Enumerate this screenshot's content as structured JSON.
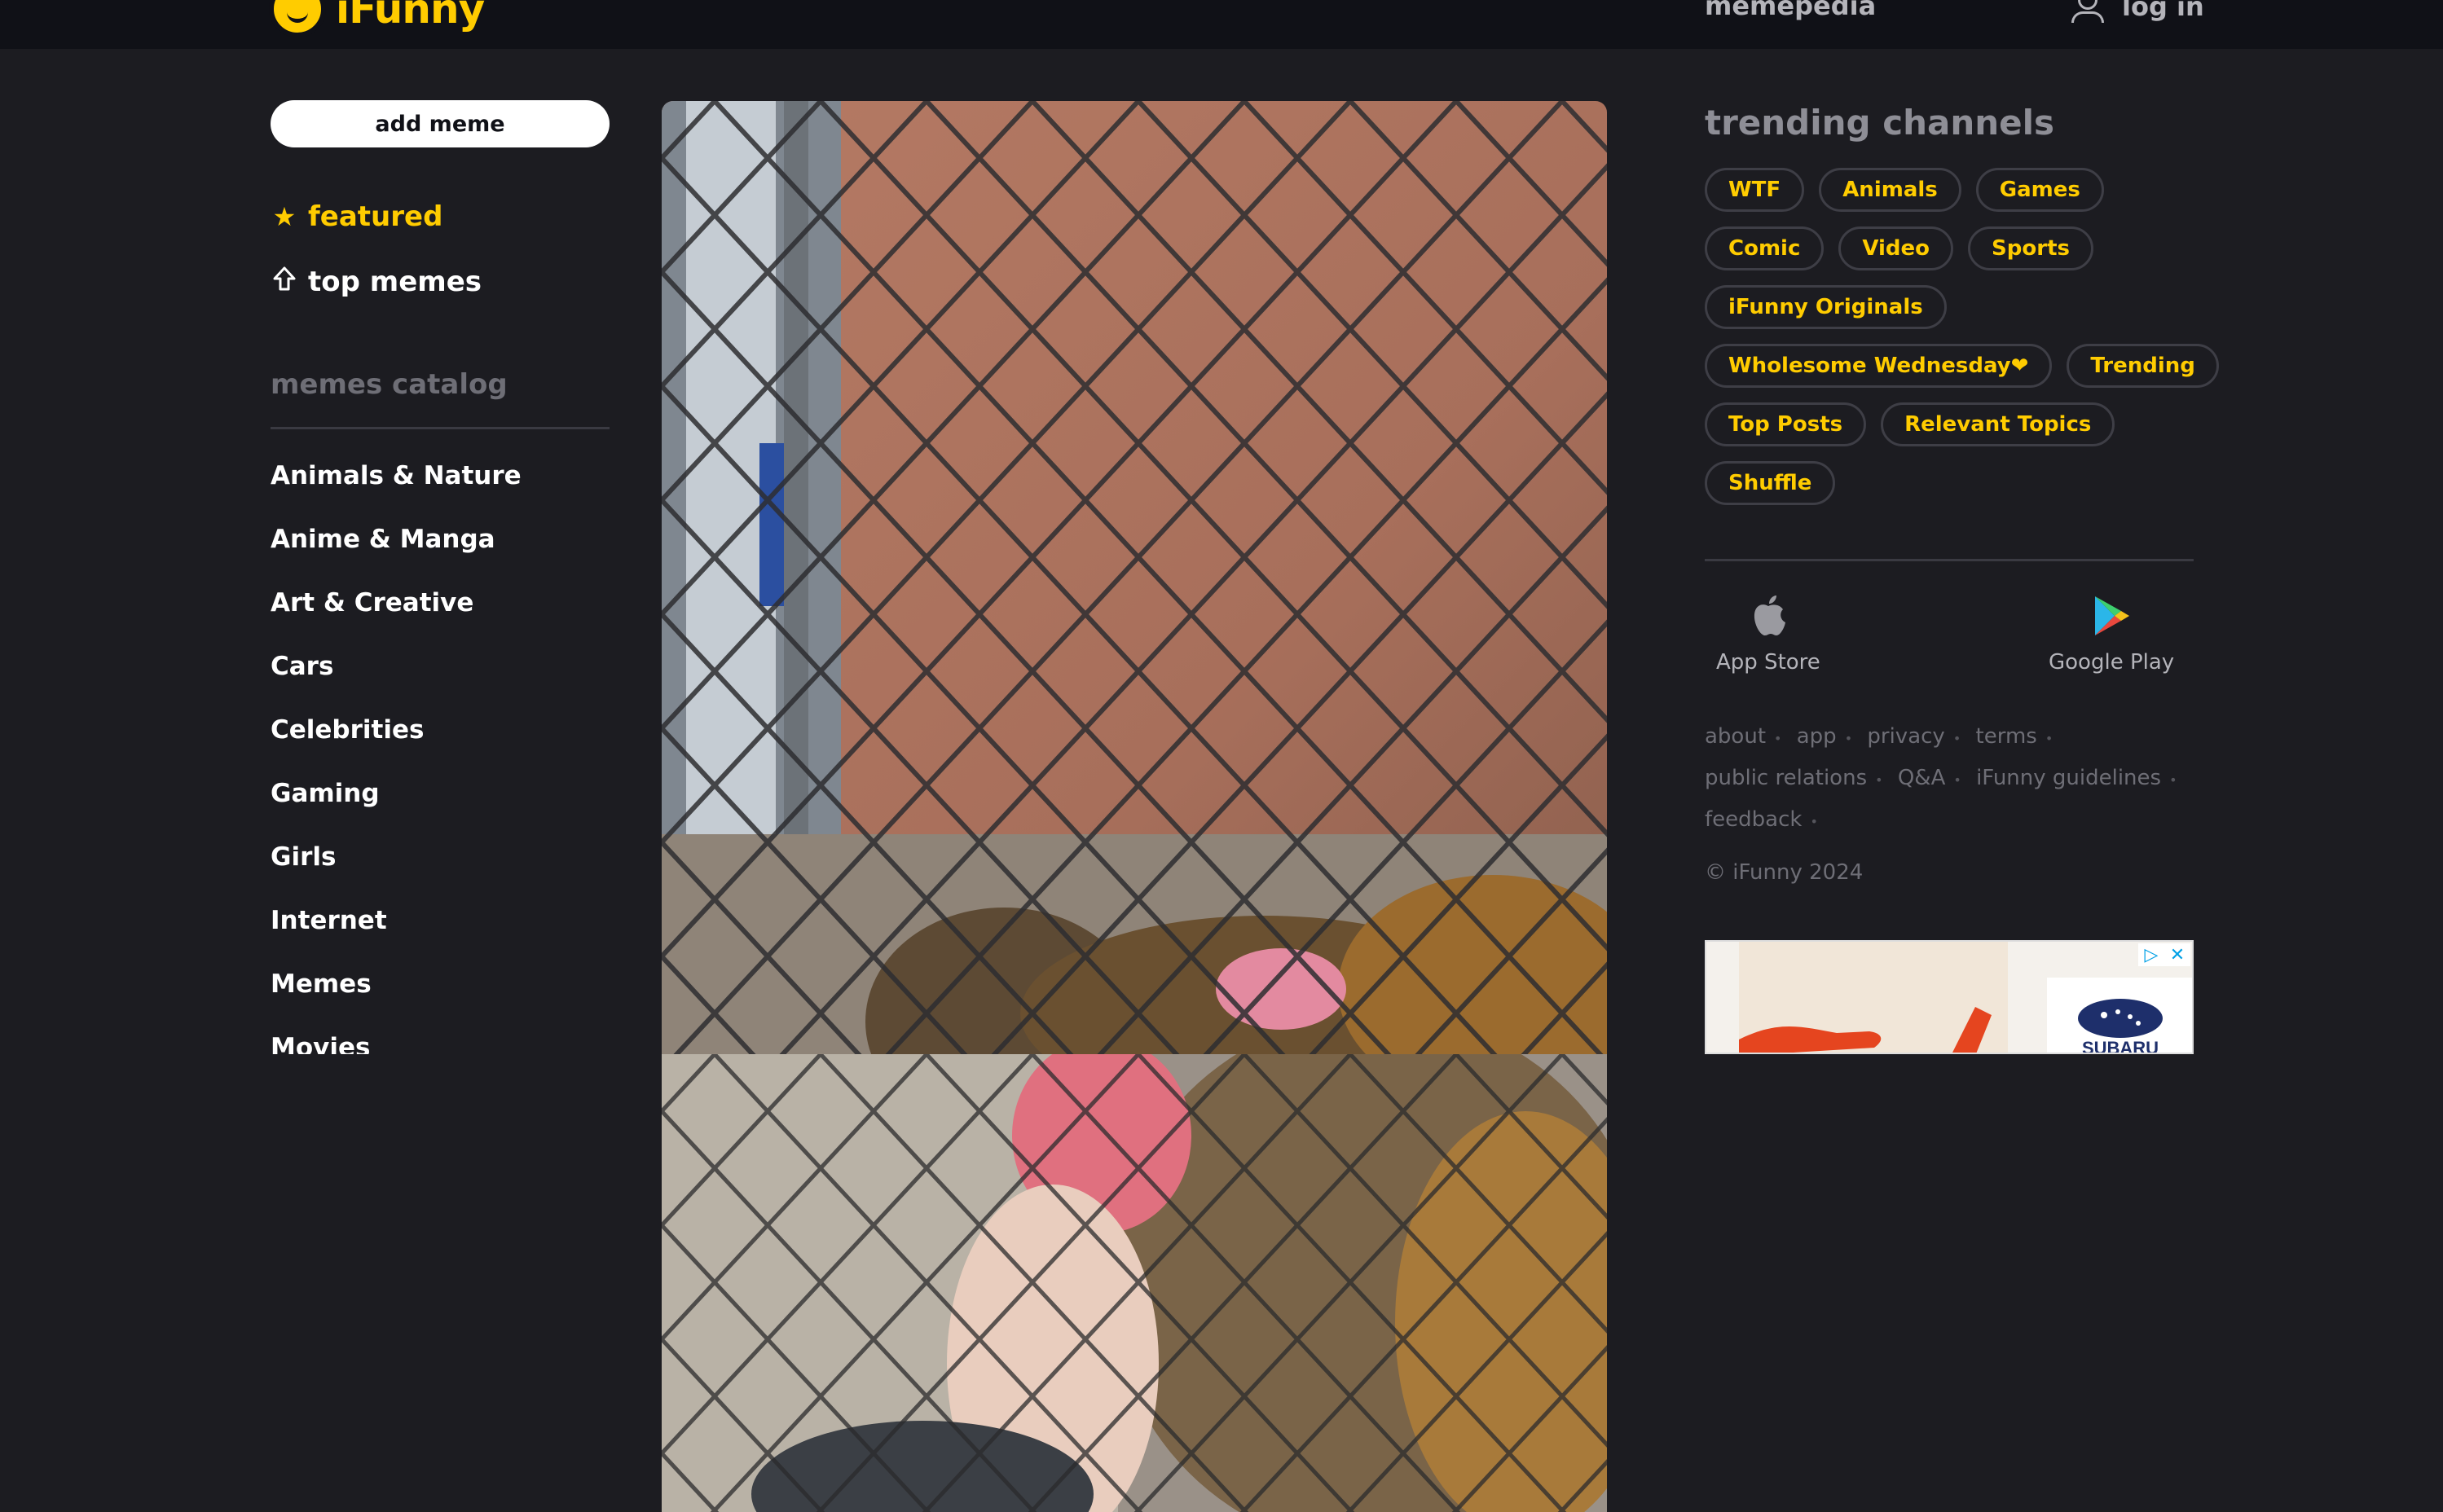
{
  "header": {
    "logo_text": "iFunny",
    "memepedia_label": "memepedia",
    "login_label": "log in"
  },
  "sidebar": {
    "add_meme_label": "add meme",
    "featured_label": "featured",
    "top_memes_label": "top memes",
    "catalog_title": "memes catalog",
    "catalog_items": [
      "Animals & Nature",
      "Anime & Manga",
      "Art & Creative",
      "Cars",
      "Celebrities",
      "Gaming",
      "Girls",
      "Internet",
      "Memes",
      "Movies"
    ]
  },
  "trending": {
    "title": "trending channels",
    "rows": [
      [
        "WTF",
        "Animals",
        "Games"
      ],
      [
        "Comic",
        "Video",
        "Sports"
      ],
      [
        "iFunny Originals"
      ],
      [
        "Wholesome Wednesday❤",
        "Trending"
      ],
      [
        "Top Posts",
        "Relevant Topics"
      ],
      [
        "Shuffle"
      ]
    ]
  },
  "stores": {
    "app_store": "App Store",
    "google_play": "Google Play"
  },
  "footer": {
    "links": [
      "about",
      "app",
      "privacy",
      "terms",
      "public relations",
      "Q&A",
      "iFunny guidelines",
      "feedback"
    ],
    "copyright": "© iFunny 2024"
  },
  "ad": {
    "brand": "SUBARU"
  },
  "colors": {
    "accent": "#ffcc00",
    "background": "#1c1c21",
    "topbar": "#101117"
  },
  "icons": {
    "featured": "star-icon",
    "top_memes": "arrow-up-icon",
    "login": "user-icon",
    "app_store": "apple-icon",
    "google_play": "google-play-icon"
  }
}
